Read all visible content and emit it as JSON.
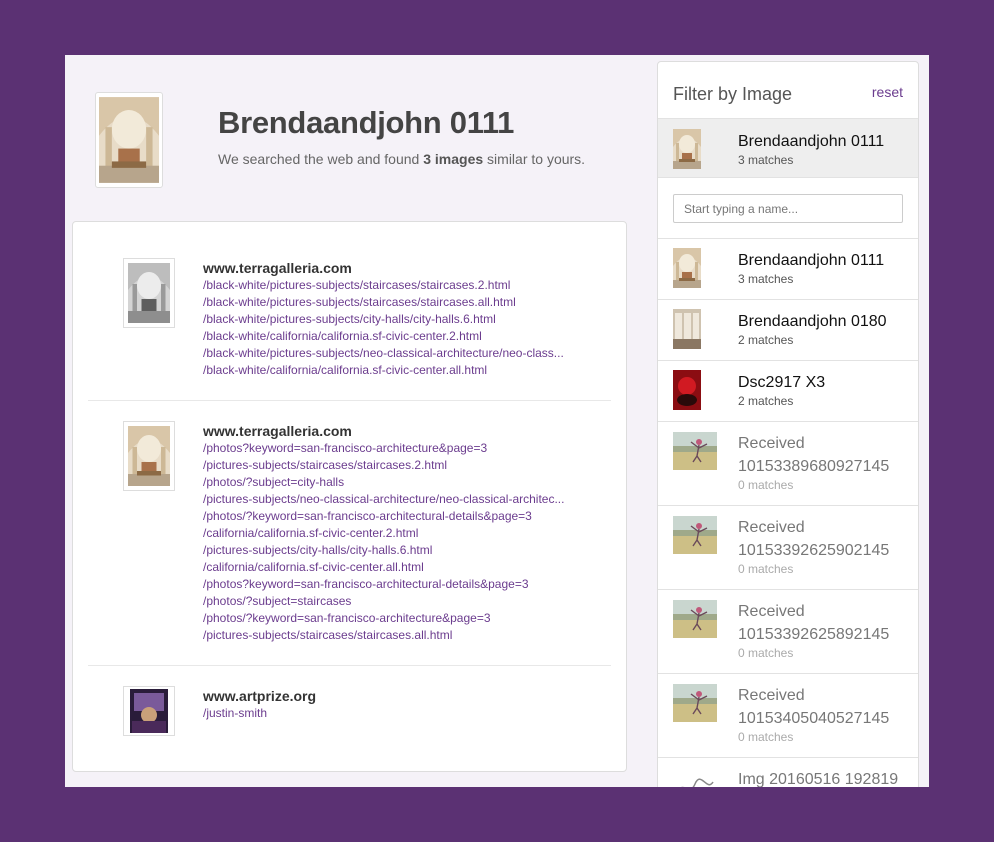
{
  "header": {
    "title": "Brendaandjohn 0111",
    "subtitle_prefix": "We searched the web and found ",
    "subtitle_count": "3 images",
    "subtitle_suffix": " similar to yours."
  },
  "results": [
    {
      "site": "www.terragalleria.com",
      "links": [
        "/black-white/pictures-subjects/staircases/staircases.2.html",
        "/black-white/pictures-subjects/staircases/staircases.all.html",
        "/black-white/pictures-subjects/city-halls/city-halls.6.html",
        "/black-white/california/california.sf-civic-center.2.html",
        "/black-white/pictures-subjects/neo-classical-architecture/neo-class...",
        "/black-white/california/california.sf-civic-center.all.html"
      ]
    },
    {
      "site": "www.terragalleria.com",
      "links": [
        "/photos?keyword=san-francisco-architecture&page=3",
        "/pictures-subjects/staircases/staircases.2.html",
        "/photos/?subject=city-halls",
        "/pictures-subjects/neo-classical-architecture/neo-classical-architec...",
        "/photos/?keyword=san-francisco-architectural-details&page=3",
        "/california/california.sf-civic-center.2.html",
        "/pictures-subjects/city-halls/city-halls.6.html",
        "/california/california.sf-civic-center.all.html",
        "/photos?keyword=san-francisco-architectural-details&page=3",
        "/photos/?subject=staircases",
        "/photos/?keyword=san-francisco-architecture&page=3",
        "/pictures-subjects/staircases/staircases.all.html"
      ]
    },
    {
      "site": "www.artprize.org",
      "links": [
        "/justin-smith"
      ]
    }
  ],
  "sidebar": {
    "title": "Filter by Image",
    "reset": "reset",
    "selected": {
      "name": "Brendaandjohn 0111",
      "count": "3 matches"
    },
    "search_placeholder": "Start typing a name...",
    "items": [
      {
        "name": "Brendaandjohn 0111",
        "count": "3 matches"
      },
      {
        "name": "Brendaandjohn 0180",
        "count": "2 matches"
      },
      {
        "name": "Dsc2917 X3",
        "count": "2 matches"
      },
      {
        "name": "Received 10153389680927145",
        "count": "0 matches"
      },
      {
        "name": "Received 10153392625902145",
        "count": "0 matches"
      },
      {
        "name": "Received 10153392625892145",
        "count": "0 matches"
      },
      {
        "name": "Received 10153405040527145",
        "count": "0 matches"
      },
      {
        "name": "Img 20160516 192819",
        "count": ""
      }
    ]
  },
  "colors": {
    "background": "#5b3173",
    "link": "#6b3c8e",
    "panel": "#f5f2f8"
  }
}
